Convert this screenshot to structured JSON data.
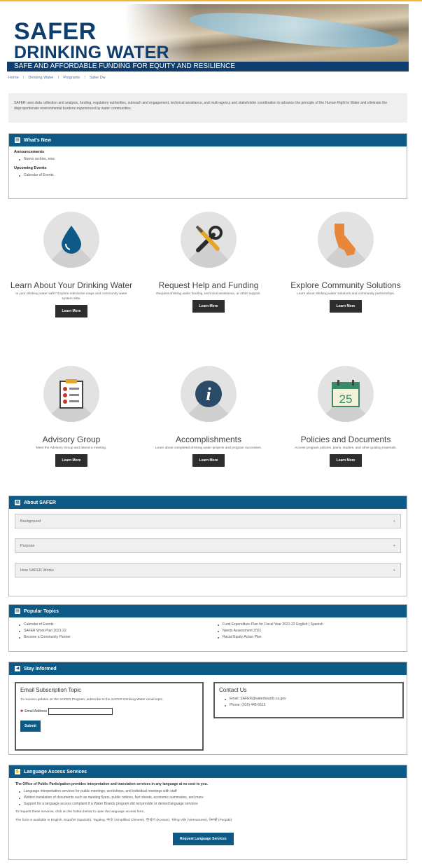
{
  "banner": {
    "title_line1": "SAFER",
    "title_line2": "DRINKING WATER",
    "tagline": "SAFE AND AFFORDABLE FUNDING FOR EQUITY AND RESILIENCE"
  },
  "breadcrumb": [
    "Home",
    "Drinking Water",
    "Programs",
    "Safer Dw"
  ],
  "intro": "SAFER uses data collection and analysis, funding, regulatory authorities, outreach and engagement, technical assistance, and multi-agency and stakeholder coordination to advance the principle of the Human Right to Water and eliminate the disproportionate environmental burdens experienced by water communities.",
  "whats_new": {
    "header": "What's New",
    "announcements_label": "Announcements",
    "announcements": [
      "Nuevo archivo, now"
    ],
    "events_label": "Upcoming Events",
    "events": [
      "Calendar of Events"
    ]
  },
  "tiles": [
    {
      "title": "Learn About Your Drinking Water",
      "desc": "Is your drinking water safe? Explore interactive maps and community water system data.",
      "button": "Learn More",
      "icon": "water-drop-icon"
    },
    {
      "title": "Request Help and Funding",
      "desc": "Request drinking water funding, technical assistance, or other support.",
      "button": "Learn More",
      "icon": "tools-icon"
    },
    {
      "title": "Explore Community Solutions",
      "desc": "Learn about drinking water solutions and community partnerships.",
      "button": "Learn More",
      "icon": "california-map-icon"
    },
    {
      "title": "Advisory Group",
      "desc": "Meet the Advisory Group and attend a meeting.",
      "button": "Learn More",
      "icon": "checklist-icon"
    },
    {
      "title": "Accomplishments",
      "desc": "Learn about completed drinking water projects and program successes.",
      "button": "Learn More",
      "icon": "info-icon"
    },
    {
      "title": "Policies and Documents",
      "desc": "Access program policies, plans, studies, and other guiding materials.",
      "button": "Learn More",
      "icon": "calendar-icon",
      "calendar_day": "25"
    }
  ],
  "about": {
    "header": "About SAFER",
    "items": [
      "Background",
      "Purpose",
      "How SAFER Works"
    ],
    "expand_glyph": "+"
  },
  "popular": {
    "header": "Popular Topics",
    "left": [
      "Calendar of Events",
      "SAFER Work Plan 2021-22",
      "Become a Community Partner"
    ],
    "right": [
      "Fund Expenditure Plan for Fiscal Year 2021-22 English | Spanish",
      "Needs Assessment 2021",
      "Racial Equity Action Plan"
    ]
  },
  "stay": {
    "header": "Stay Informed",
    "email_title": "Email Subscription Topic",
    "email_text": "To receive updates on the SAFER Program, subscribe to the SAFER Drinking Water email topic.",
    "email_label_marker": "✱",
    "email_label": "Email Address",
    "submit": "Submit",
    "contact_title": "Contact Us",
    "contact_lines": [
      "Email: SAFER@waterboards.ca.gov",
      "Phone: (916) 445-5615"
    ]
  },
  "language": {
    "header": "Language Access Services",
    "lead": "The Office of Public Participation provides interpretation and translation services in any language at no cost to you.",
    "items": [
      "Language interpretation services for public meetings, workshops, and individual meetings with staff",
      "Written translation of documents such as meeting flyers, public notices, fact sheets, economic summaries, and more",
      "Support for a language access complaint if a Water Boards program did not provide or denied language services"
    ],
    "note1": "To request these services, click on the button below to open the language access form.",
    "note2": "The form is available in English, Español (Spanish), Tagalog, 中文 (Simplified Chinese), 한국어 (Korean), Tiếng Việt (Vietnamese), ਪੰਜਾਬੀ (Punjabi)",
    "button": "Request Language Services"
  },
  "colors": {
    "navy": "#0e3d6e",
    "panel_blue": "#0e5a86",
    "dark_button": "#2d2d2d",
    "gold_line": "#f2b632"
  }
}
